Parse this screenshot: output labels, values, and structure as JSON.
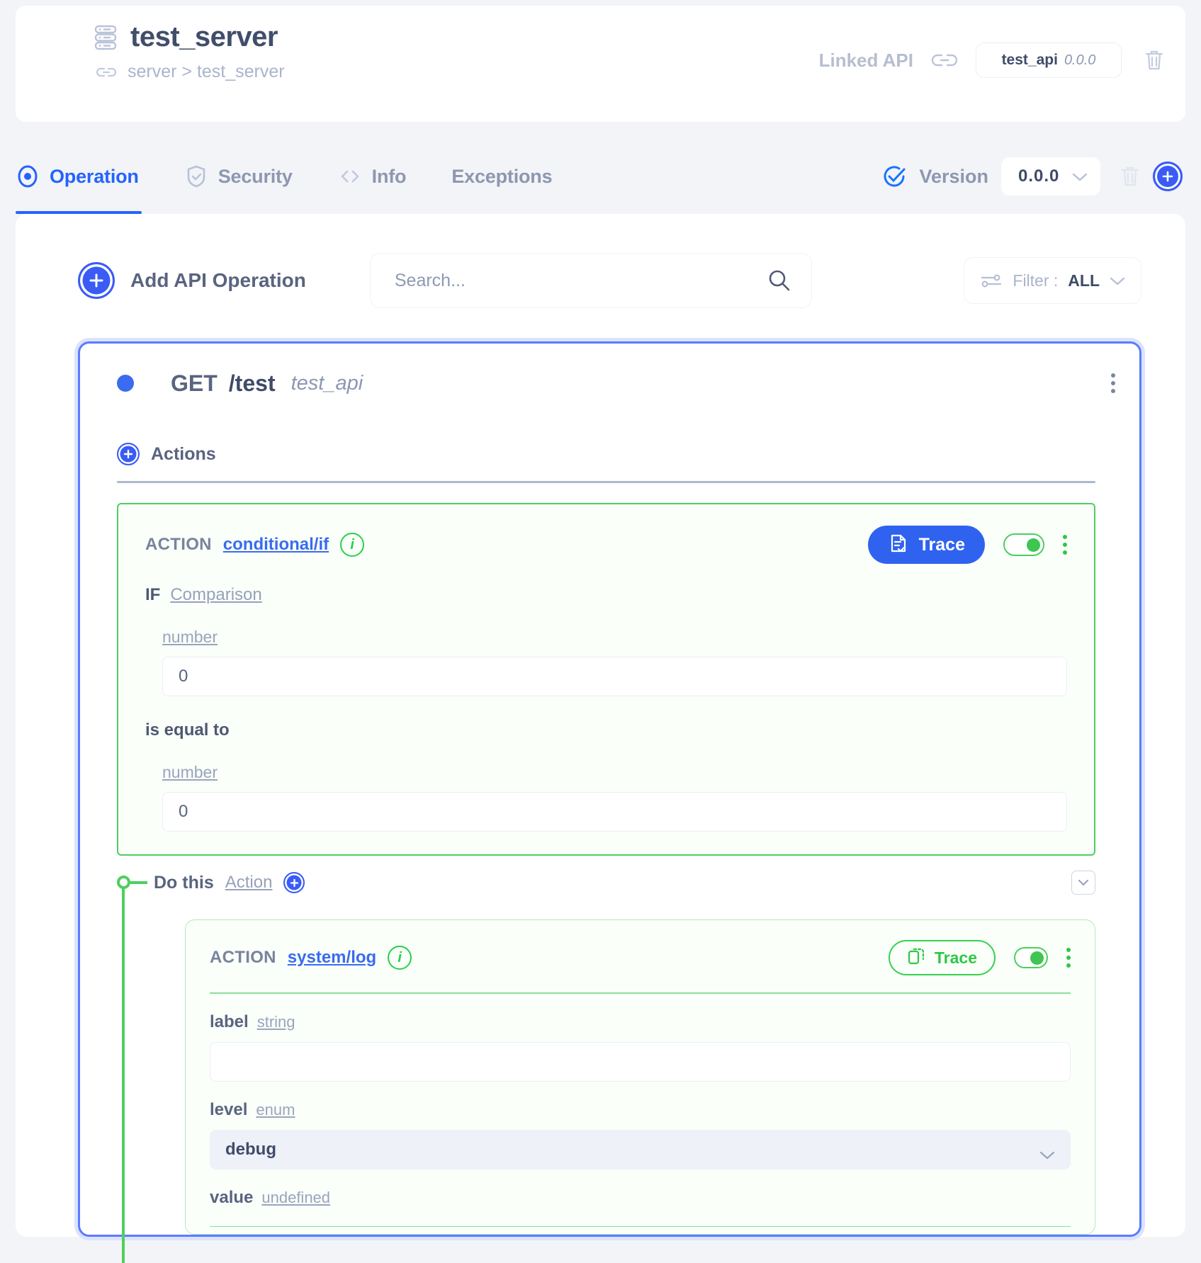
{
  "header": {
    "server_icon": "server-rack-icon",
    "title": "test_server",
    "breadcrumb_icon": "link-icon",
    "breadcrumb": "server > test_server",
    "linked_api_label": "Linked API",
    "chain_icon": "chain-link-icon",
    "linked_api_name": "test_api",
    "linked_api_version": "0.0.0",
    "delete_icon": "trash-icon"
  },
  "tabs": [
    {
      "label": "Operation",
      "icon": "radio-target-icon",
      "active": true
    },
    {
      "label": "Security",
      "icon": "shield-check-icon",
      "active": false
    },
    {
      "label": "Info",
      "icon": "code-brackets-icon",
      "active": false
    },
    {
      "label": "Exceptions",
      "icon": "",
      "active": false
    }
  ],
  "version_bar": {
    "check_icon": "check-circle-icon",
    "label": "Version",
    "value": "0.0.0",
    "chevron_icon": "chevron-down-icon",
    "delete_icon": "trash-icon",
    "add_icon": "plus-circle-icon"
  },
  "toolbar": {
    "add_operation_label": "Add API Operation",
    "add_operation_icon": "plus-circle-icon",
    "search_placeholder": "Search...",
    "search_value": "",
    "search_icon": "search-icon",
    "filter_icon": "sliders-icon",
    "filter_label": "Filter :",
    "filter_value": "ALL",
    "filter_chevron": "chevron-down-icon"
  },
  "operation": {
    "status_dot": "status-dot-blue",
    "method": "GET",
    "path": "/test",
    "api": "test_api",
    "menu_icon": "kebab-menu-icon",
    "actions_label": "Actions",
    "actions_add_icon": "plus-circle-icon"
  },
  "conditional_action": {
    "keyword": "ACTION",
    "name": "conditional/if",
    "info_icon": "info-icon",
    "trace_label": "Trace",
    "trace_icon": "trace-document-icon",
    "toggle_state": "on",
    "menu_icon": "kebab-menu-icon",
    "if_keyword": "IF",
    "comparison_link": "Comparison",
    "left_type": "number",
    "left_value": "0",
    "operator": "is equal to",
    "right_type": "number",
    "right_value": "0"
  },
  "branch": {
    "do_label": "Do this",
    "action_link": "Action",
    "add_icon": "plus-circle-icon",
    "collapse_icon": "chevron-down-box-icon"
  },
  "log_action": {
    "keyword": "ACTION",
    "name": "system/log",
    "info_icon": "info-icon",
    "trace_label": "Trace",
    "trace_icon": "trace-copy-icon",
    "toggle_state": "on",
    "menu_icon": "kebab-menu-icon",
    "fields": [
      {
        "name": "label",
        "type": "string",
        "value": "",
        "control": "text"
      },
      {
        "name": "level",
        "type": "enum",
        "value": "debug",
        "control": "select"
      },
      {
        "name": "value",
        "type": "undefined",
        "value": "",
        "control": "none"
      }
    ]
  },
  "colors": {
    "accent_blue": "#3a5cf5",
    "accent_green": "#4fcf5f",
    "text_dark": "#3f4b69",
    "text_muted": "#8d97b0",
    "page_bg": "#f2f4f7"
  }
}
